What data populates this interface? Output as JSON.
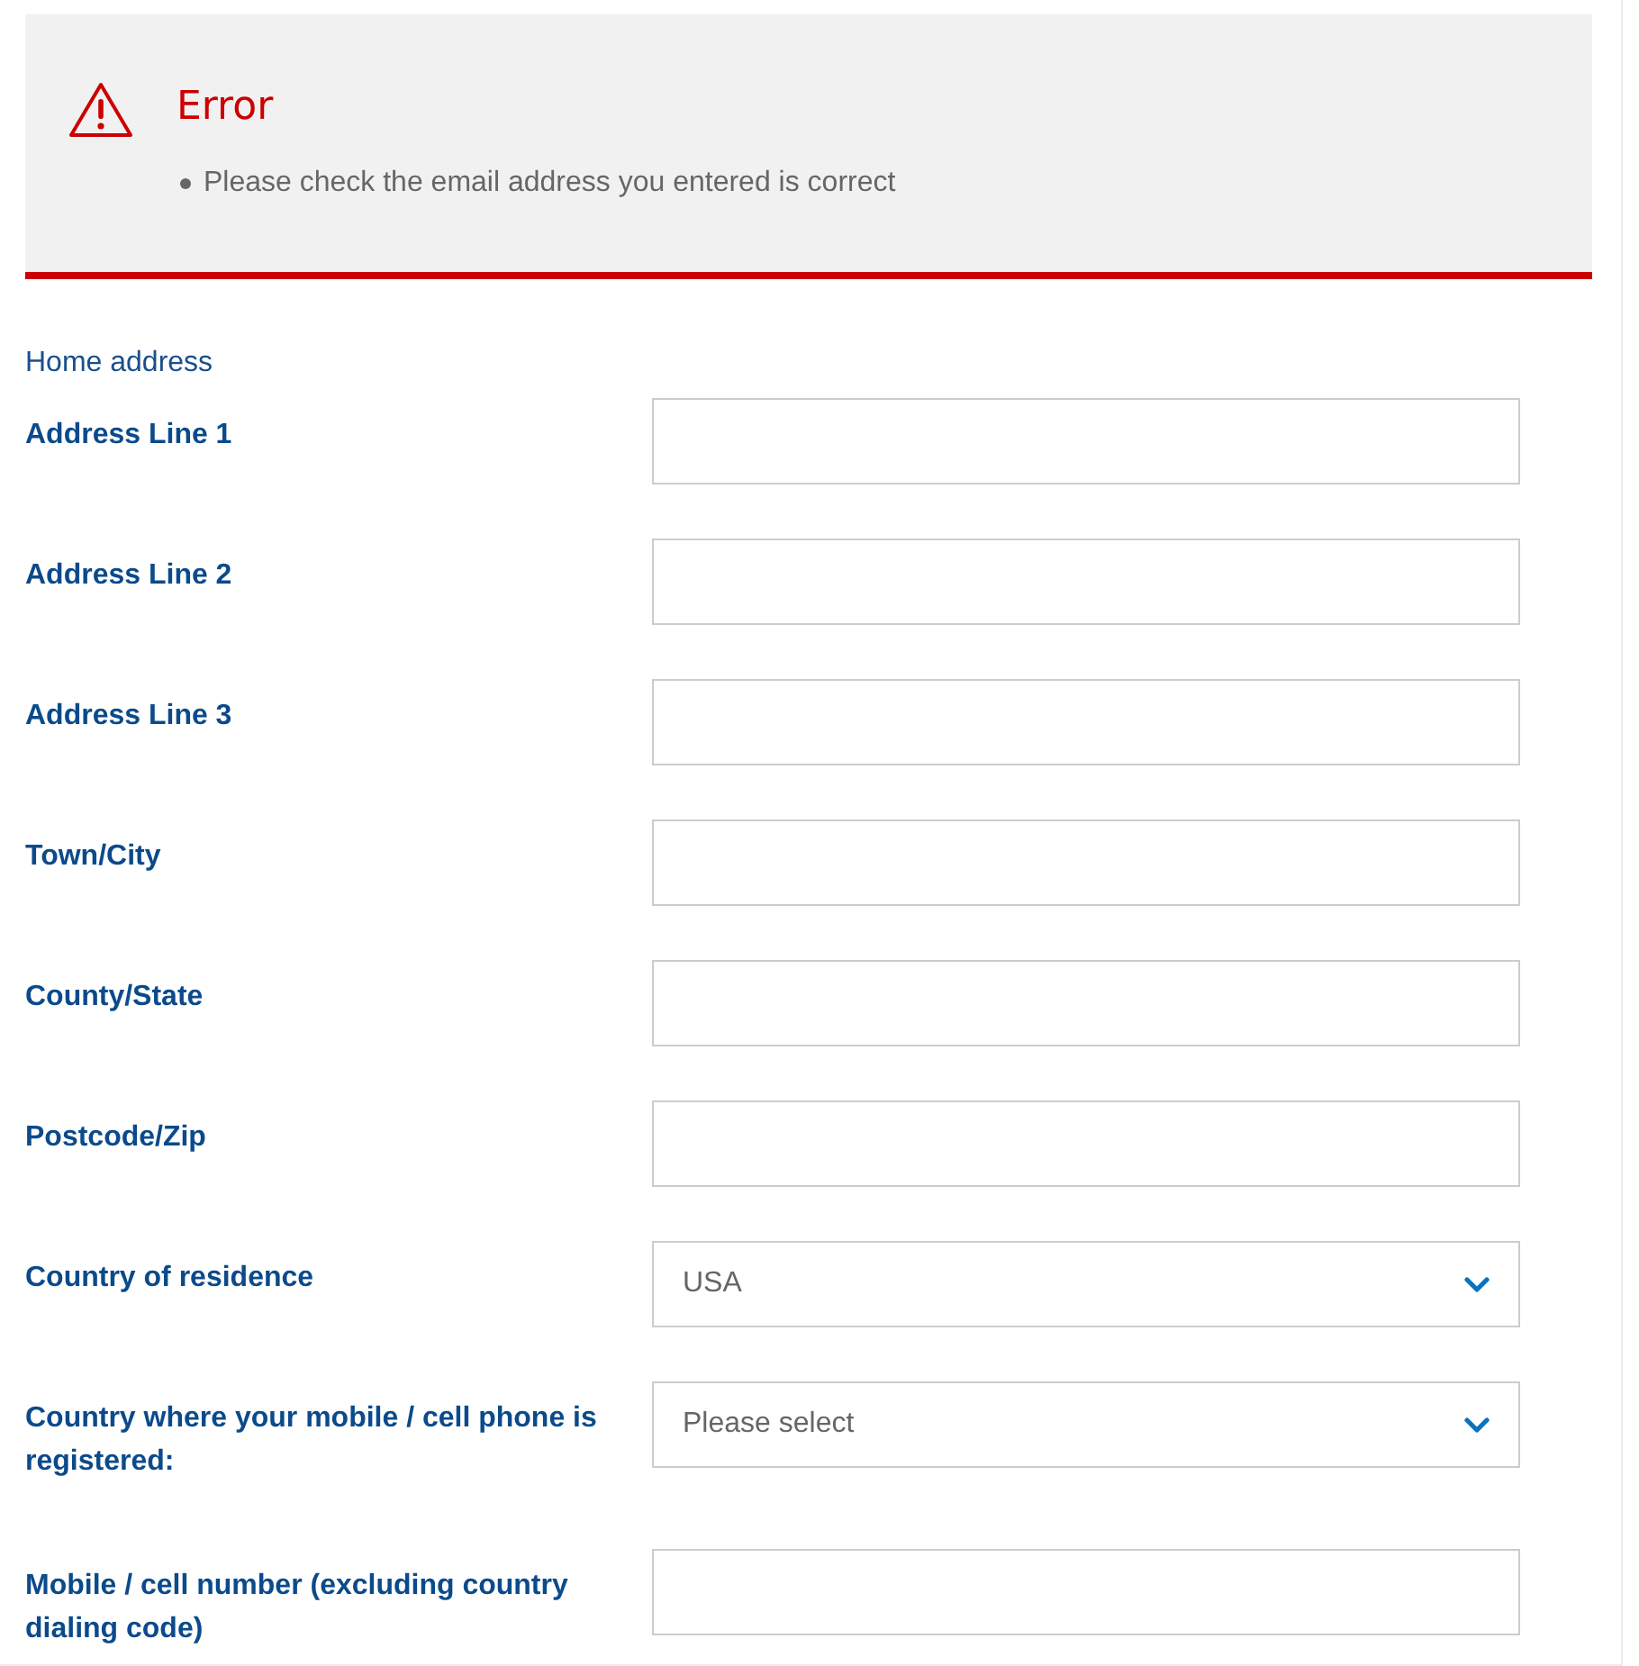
{
  "error_panel": {
    "title": "Error",
    "messages": [
      "Please check the email address you entered is correct"
    ]
  },
  "section_title": "Home address",
  "fields": [
    {
      "kind": "text",
      "label": "Address Line 1"
    },
    {
      "kind": "text",
      "label": "Address Line 2"
    },
    {
      "kind": "text",
      "label": "Address Line 3"
    },
    {
      "kind": "text",
      "label": "Town/City"
    },
    {
      "kind": "text",
      "label": "County/State"
    },
    {
      "kind": "text",
      "label": "Postcode/Zip"
    },
    {
      "kind": "select",
      "label": "Country of residence",
      "value": "USA"
    },
    {
      "kind": "select",
      "label": "Country where your mobile / cell phone is registered:",
      "placeholder": "Please select"
    },
    {
      "kind": "text",
      "label": "Mobile / cell number (excluding country dialing code)"
    }
  ]
}
